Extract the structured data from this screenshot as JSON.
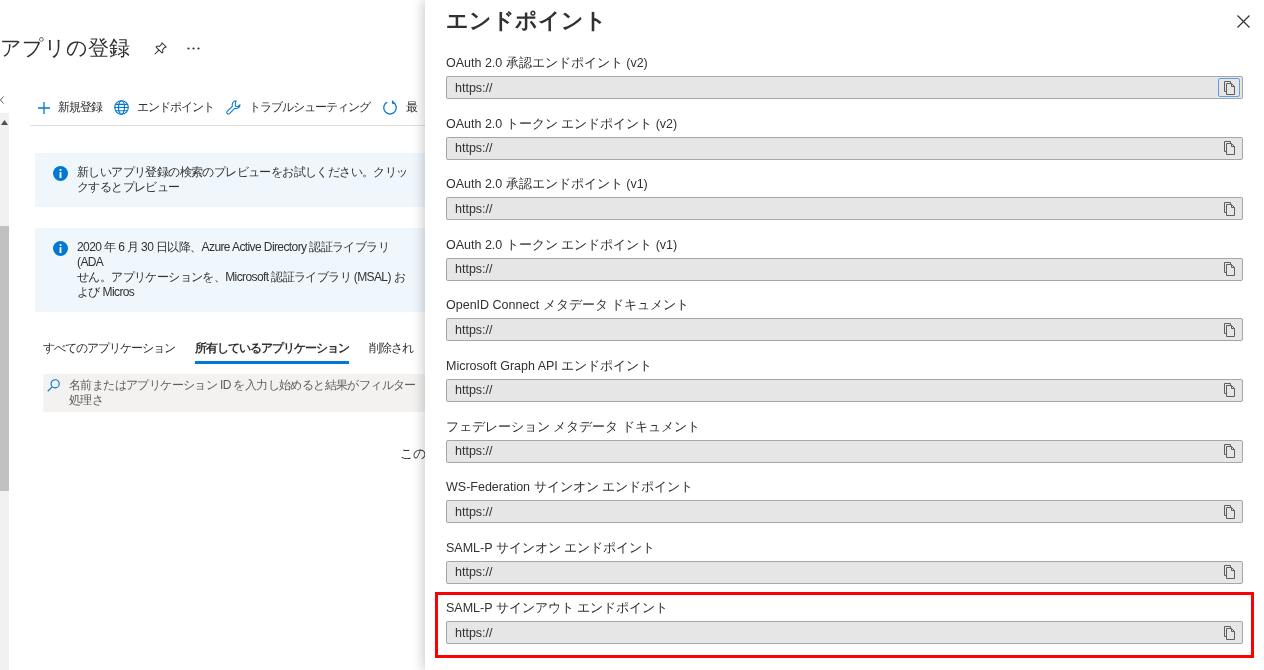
{
  "page": {
    "title": "アプリの登録"
  },
  "toolbar": [
    {
      "label": "新規登録",
      "kind": "plus"
    },
    {
      "label": "エンドポイント",
      "kind": "globe"
    },
    {
      "label": "トラブルシューティング",
      "kind": "wrench"
    },
    {
      "label": "最",
      "kind": "refresh"
    }
  ],
  "banners": [
    {
      "lines": [
        "新しいアプリ登録の検索のプレビューをお試しください。クリックするとプレビュー"
      ]
    },
    {
      "lines": [
        "2020 年 6 月 30 日以降、Azure Active Directory 認証ライブラリ (ADA",
        "せん。アプリケーションを、Microsoft 認証ライブラリ (MSAL) および Micros"
      ]
    }
  ],
  "tabs": [
    {
      "label": "すべてのアプリケーション",
      "selected": false
    },
    {
      "label": "所有しているアプリケーション",
      "selected": true
    },
    {
      "label": "削除され",
      "selected": false
    }
  ],
  "search": {
    "placeholder": "名前またはアプリケーション ID を入力し始めると結果がフィルター処理さ"
  },
  "list_message": "この",
  "panel": {
    "title": "エンドポイント",
    "endpoints": [
      {
        "label": "OAuth 2.0 承認エンドポイント (v2)",
        "value": "https://",
        "copy_focused": true,
        "highlighted": false
      },
      {
        "label": "OAuth 2.0 トークン エンドポイント (v2)",
        "value": "https://",
        "copy_focused": false,
        "highlighted": false
      },
      {
        "label": "OAuth 2.0 承認エンドポイント (v1)",
        "value": "https://",
        "copy_focused": false,
        "highlighted": false
      },
      {
        "label": "OAuth 2.0 トークン エンドポイント (v1)",
        "value": "https://",
        "copy_focused": false,
        "highlighted": false
      },
      {
        "label": "OpenID Connect メタデータ ドキュメント",
        "value": "https://",
        "copy_focused": false,
        "highlighted": false
      },
      {
        "label": "Microsoft Graph API エンドポイント",
        "value": "https://",
        "copy_focused": false,
        "highlighted": false
      },
      {
        "label": "フェデレーション メタデータ ドキュメント",
        "value": "https://",
        "copy_focused": false,
        "highlighted": false
      },
      {
        "label": "WS-Federation サインオン エンドポイント",
        "value": "https://",
        "copy_focused": false,
        "highlighted": false
      },
      {
        "label": "SAML-P サインオン エンドポイント",
        "value": "https://",
        "copy_focused": false,
        "highlighted": false
      },
      {
        "label": "SAML-P サインアウト エンドポイント",
        "value": "https://",
        "copy_focused": false,
        "highlighted": true
      }
    ]
  }
}
